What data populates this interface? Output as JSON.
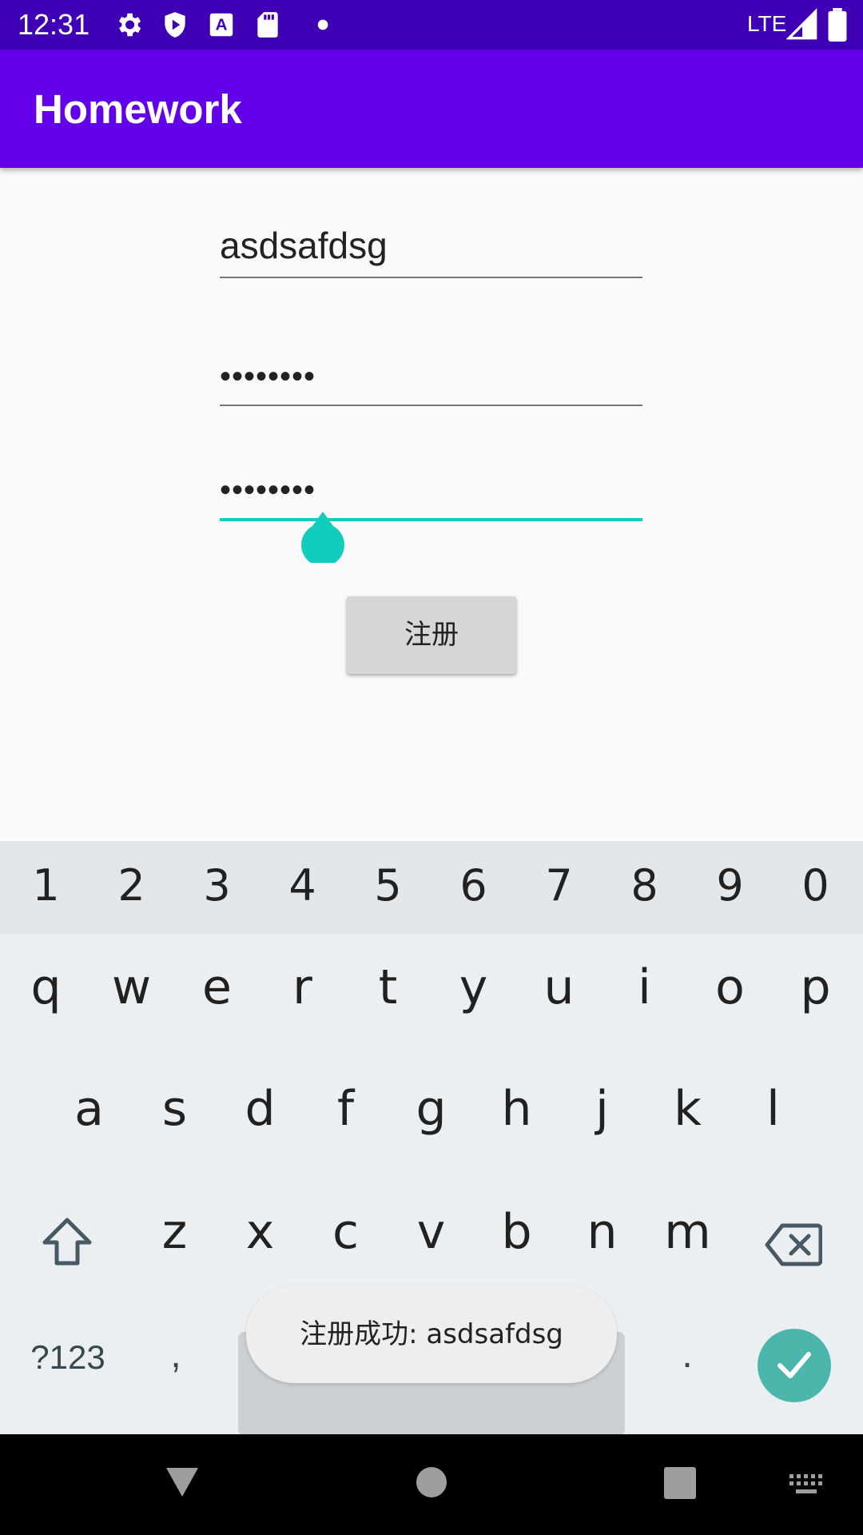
{
  "status_bar": {
    "time": "12:31",
    "network": "LTE",
    "icons": [
      "gear-icon",
      "shield-icon",
      "text-a-icon",
      "sd-card-icon",
      "dot-icon",
      "signal-icon",
      "battery-icon"
    ]
  },
  "app_bar": {
    "title": "Homework"
  },
  "form": {
    "username_value": "asdsafdsg",
    "password_value": "••••••••",
    "confirm_password_value": "••••••••",
    "register_label": "注册"
  },
  "toast": {
    "text": "注册成功: asdsafdsg"
  },
  "keyboard": {
    "number_row": [
      "1",
      "2",
      "3",
      "4",
      "5",
      "6",
      "7",
      "8",
      "9",
      "0"
    ],
    "row_q": [
      "q",
      "w",
      "e",
      "r",
      "t",
      "y",
      "u",
      "i",
      "o",
      "p"
    ],
    "row_a": [
      "a",
      "s",
      "d",
      "f",
      "g",
      "h",
      "j",
      "k",
      "l"
    ],
    "row_z": [
      "z",
      "x",
      "c",
      "v",
      "b",
      "n",
      "m"
    ],
    "symbols_label": "?123",
    "comma_label": ",",
    "period_label": "."
  },
  "colors": {
    "status_bar": "#3f00b5",
    "app_bar": "#6200ea",
    "focus_accent": "#12cdbc",
    "enter_key": "#4db6ac"
  }
}
